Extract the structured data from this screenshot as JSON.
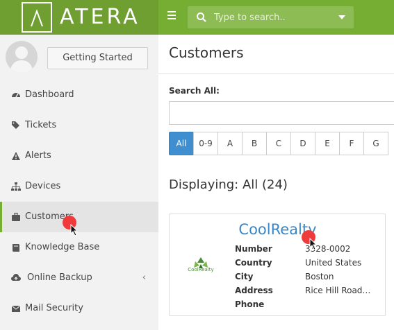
{
  "brand": {
    "name": "ATERA"
  },
  "search": {
    "placeholder": "Type to search.."
  },
  "sidebar": {
    "getting_started_label": "Getting Started",
    "items": [
      {
        "label": "Dashboard",
        "icon": "dashboard-icon"
      },
      {
        "label": "Tickets",
        "icon": "tags-icon"
      },
      {
        "label": "Alerts",
        "icon": "warning-icon"
      },
      {
        "label": "Devices",
        "icon": "sitemap-icon"
      },
      {
        "label": "Customers",
        "icon": "briefcase-icon",
        "active": true
      },
      {
        "label": "Knowledge Base",
        "icon": "book-icon"
      },
      {
        "label": "Online Backup",
        "icon": "cloud-upload-icon",
        "chevron": "‹"
      },
      {
        "label": "Mail Security",
        "icon": "envelope-icon"
      }
    ]
  },
  "main": {
    "title": "Customers",
    "search_all_label": "Search All:",
    "letters": [
      "All",
      "0-9",
      "A",
      "B",
      "C",
      "D",
      "E",
      "F",
      "G"
    ],
    "displaying": "Displaying: All (24)"
  },
  "customer_card": {
    "name": "CoolRealty",
    "logo_text": "CoolRealty",
    "fields": [
      {
        "label": "Number",
        "value": "3328-0002"
      },
      {
        "label": "Country",
        "value": "United States"
      },
      {
        "label": "City",
        "value": "Boston"
      },
      {
        "label": "Address",
        "value": "Rice Hill Road…"
      },
      {
        "label": "Phone",
        "value": ""
      }
    ]
  },
  "colors": {
    "topbar": "#76ad33",
    "accent_blue": "#3f8fd0",
    "click_marker": "#ef3b3b"
  }
}
